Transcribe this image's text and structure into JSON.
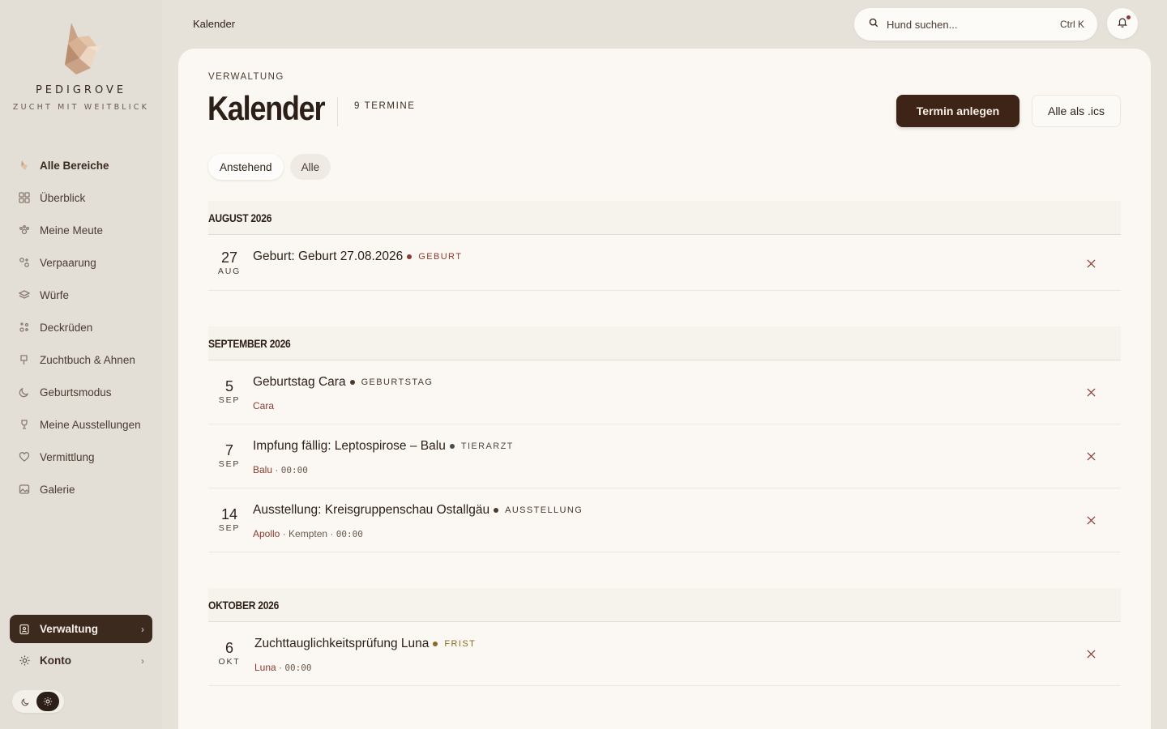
{
  "brand": {
    "name": "PEDIGROVE",
    "tagline": "ZUCHT MIT WEITBLICK"
  },
  "sidebar": {
    "items": [
      {
        "label": "Alle Bereiche",
        "icon": "fox-icon"
      },
      {
        "label": "Überblick",
        "icon": "grid-icon"
      },
      {
        "label": "Meine Meute",
        "icon": "paw-icon"
      },
      {
        "label": "Verpaarung",
        "icon": "pairing-icon"
      },
      {
        "label": "Würfe",
        "icon": "layers-icon"
      },
      {
        "label": "Deckrüden",
        "icon": "dots-icon"
      },
      {
        "label": "Zuchtbuch & Ahnen",
        "icon": "book-icon"
      },
      {
        "label": "Geburtsmodus",
        "icon": "moon-icon"
      },
      {
        "label": "Meine Ausstellungen",
        "icon": "trophy-icon"
      },
      {
        "label": "Vermittlung",
        "icon": "heart-icon"
      },
      {
        "label": "Galerie",
        "icon": "image-icon"
      }
    ],
    "bottom": [
      {
        "label": "Verwaltung",
        "icon": "admin-icon"
      },
      {
        "label": "Konto",
        "icon": "gear-icon"
      }
    ]
  },
  "header": {
    "breadcrumb": "Kalender",
    "search_placeholder": "Hund suchen...",
    "search_shortcut": "Ctrl K"
  },
  "page": {
    "kicker": "VERWALTUNG",
    "title": "Kalender",
    "count": "9 TERMINE",
    "primary_button": "Termin anlegen",
    "secondary_button": "Alle als .ics",
    "filters": [
      "Anstehend",
      "Alle"
    ]
  },
  "colors": {
    "accent_dark": "#3d2416",
    "dog_link": "#8b3a2e",
    "tag_geburt": "#8b3a2e",
    "tag_geburtstag": "#4a3b31",
    "tag_tierarzt": "#4a4a4a",
    "tag_ausstellung": "#4a3b31",
    "tag_frist": "#8a6a1e"
  },
  "months": [
    {
      "label": "AUGUST 2026",
      "events": [
        {
          "day": "27",
          "month": "AUG",
          "title": "Geburt: Geburt 27.08.2026",
          "tag": "GEBURT",
          "tag_color": "#8b3a2e"
        }
      ]
    },
    {
      "label": "SEPTEMBER 2026",
      "events": [
        {
          "day": "5",
          "month": "SEP",
          "title": "Geburtstag Cara",
          "tag": "GEBURTSTAG",
          "tag_color": "#4a3b31",
          "dog": "Cara"
        },
        {
          "day": "7",
          "month": "SEP",
          "title": "Impfung fällig: Leptospirose – Balu",
          "tag": "TIERARZT",
          "tag_color": "#4a4a4a",
          "dog": "Balu",
          "time": "00:00"
        },
        {
          "day": "14",
          "month": "SEP",
          "title": "Ausstellung: Kreisgruppenschau Ostallgäu",
          "tag": "AUSSTELLUNG",
          "tag_color": "#4a3b31",
          "dog": "Apollo",
          "place": "Kempten",
          "time": "00:00"
        }
      ]
    },
    {
      "label": "OKTOBER 2026",
      "events": [
        {
          "day": "6",
          "month": "OKT",
          "title": "Zuchttauglichkeitsprüfung Luna",
          "tag": "FRIST",
          "tag_color": "#8a6a1e",
          "dog": "Luna",
          "time": "00:00"
        }
      ]
    }
  ]
}
